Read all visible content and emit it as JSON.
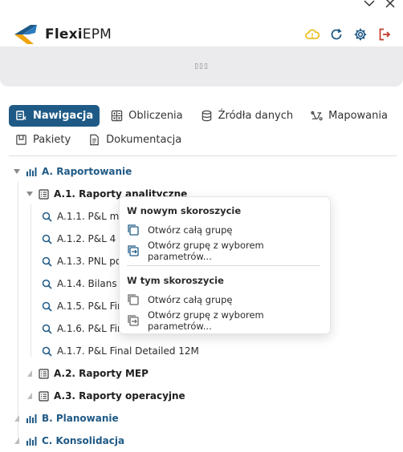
{
  "app": {
    "logo_bold": "Flexi",
    "logo_rest": "EPM",
    "banner_text": "▯▯▯"
  },
  "tabs": [
    {
      "label": "Nawigacja",
      "icon": "navigation-icon",
      "active": true
    },
    {
      "label": "Obliczenia",
      "icon": "calculator-icon",
      "active": false
    },
    {
      "label": "Źródła danych",
      "icon": "database-icon",
      "active": false
    },
    {
      "label": "Mapowania",
      "icon": "mapping-icon",
      "active": false
    },
    {
      "label": "Pakiety",
      "icon": "package-icon",
      "active": false
    },
    {
      "label": "Dokumentacja",
      "icon": "document-icon",
      "active": false
    }
  ],
  "tree": {
    "a": {
      "label": "A. Raportowanie"
    },
    "a1": {
      "label": "A.1. Raporty analityczne"
    },
    "a1_items": [
      "A.1.1. P&L mon",
      "A.1.2. P&L 4 sc",
      "A.1.3. PNL po s",
      "A.1.4. Bilans po",
      "A.1.5. P&L Fina",
      "A.1.6. P&L Fina",
      "A.1.7. P&L Final Detailed 12M"
    ],
    "a2": {
      "label": "A.2. Raporty MEP"
    },
    "a3": {
      "label": "A.3. Raporty operacyjne"
    },
    "b": {
      "label": "B. Planowanie"
    },
    "c": {
      "label": "C. Konsolidacja"
    }
  },
  "context_menu": {
    "new_tab_heading": "W nowym skoroszycie",
    "new_open_all": "Otwórz całą grupę",
    "new_open_params": "Otwórz grupę z wyborem parametrów...",
    "same_tab_heading": "W tym skoroszycie",
    "same_open_all": "Otwórz całą grupę",
    "same_open_params": "Otwórz grupę z wyborem parametrów..."
  },
  "colors": {
    "accent": "#1f5a86",
    "warning": "#e8b90c",
    "danger": "#c0392b"
  }
}
